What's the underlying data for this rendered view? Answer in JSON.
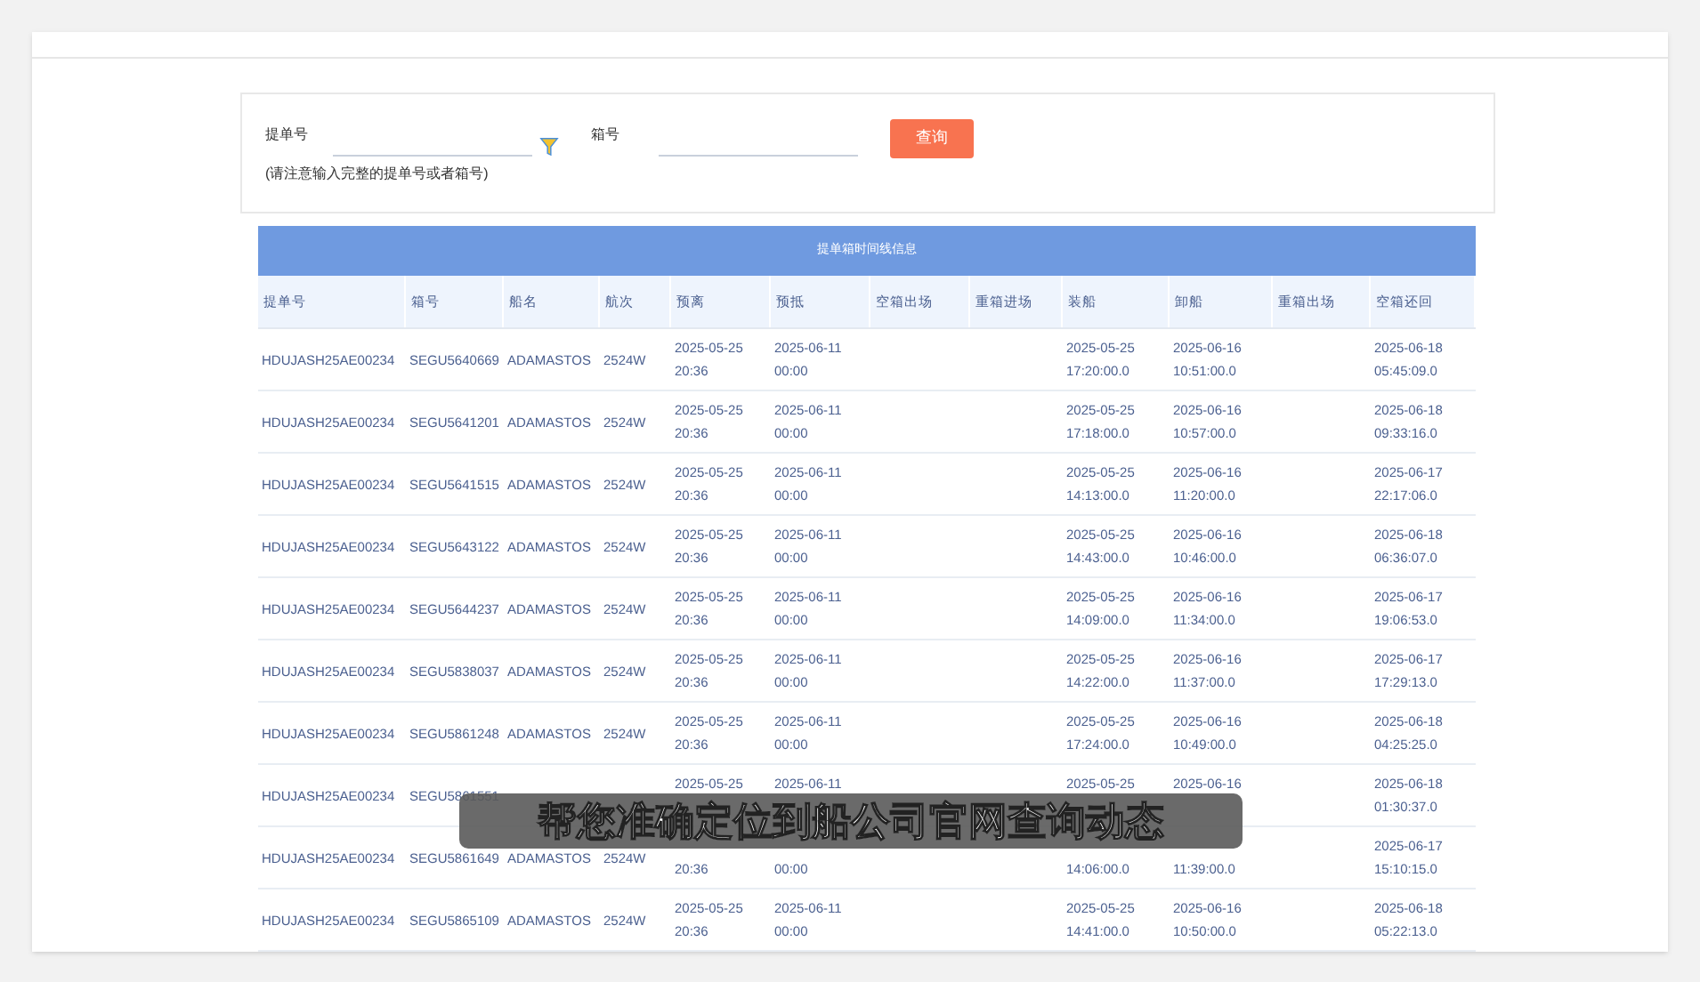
{
  "search": {
    "fields": [
      {
        "label": "提单号",
        "has_filter": true
      },
      {
        "label": "箱号",
        "has_filter": false
      }
    ],
    "button": "查询",
    "note": "(请注意输入完整的提单号或者箱号)"
  },
  "table": {
    "title": "提单箱时间线信息",
    "columns": [
      "提单号",
      "箱号",
      "船名",
      "航次",
      "预离",
      "预抵",
      "空箱出场",
      "重箱进场",
      "装船",
      "卸船",
      "重箱出场",
      "空箱还回"
    ],
    "rows": [
      {
        "cells": [
          [
            "HDUJASH25AE00234"
          ],
          [
            "SEGU5640669"
          ],
          [
            "ADAMASTOS"
          ],
          [
            "2524W"
          ],
          [
            "2025-05-25",
            "20:36"
          ],
          [
            "2025-06-11",
            "00:00"
          ],
          null,
          null,
          [
            "2025-05-25",
            "17:20:00.0"
          ],
          [
            "2025-06-16",
            "10:51:00.0"
          ],
          null,
          [
            "2025-06-18",
            "05:45:09.0"
          ]
        ]
      },
      {
        "cells": [
          [
            "HDUJASH25AE00234"
          ],
          [
            "SEGU5641201"
          ],
          [
            "ADAMASTOS"
          ],
          [
            "2524W"
          ],
          [
            "2025-05-25",
            "20:36"
          ],
          [
            "2025-06-11",
            "00:00"
          ],
          null,
          null,
          [
            "2025-05-25",
            "17:18:00.0"
          ],
          [
            "2025-06-16",
            "10:57:00.0"
          ],
          null,
          [
            "2025-06-18",
            "09:33:16.0"
          ]
        ]
      },
      {
        "cells": [
          [
            "HDUJASH25AE00234"
          ],
          [
            "SEGU5641515"
          ],
          [
            "ADAMASTOS"
          ],
          [
            "2524W"
          ],
          [
            "2025-05-25",
            "20:36"
          ],
          [
            "2025-06-11",
            "00:00"
          ],
          null,
          null,
          [
            "2025-05-25",
            "14:13:00.0"
          ],
          [
            "2025-06-16",
            "11:20:00.0"
          ],
          null,
          [
            "2025-06-17",
            "22:17:06.0"
          ]
        ]
      },
      {
        "cells": [
          [
            "HDUJASH25AE00234"
          ],
          [
            "SEGU5643122"
          ],
          [
            "ADAMASTOS"
          ],
          [
            "2524W"
          ],
          [
            "2025-05-25",
            "20:36"
          ],
          [
            "2025-06-11",
            "00:00"
          ],
          null,
          null,
          [
            "2025-05-25",
            "14:43:00.0"
          ],
          [
            "2025-06-16",
            "10:46:00.0"
          ],
          null,
          [
            "2025-06-18",
            "06:36:07.0"
          ]
        ]
      },
      {
        "cells": [
          [
            "HDUJASH25AE00234"
          ],
          [
            "SEGU5644237"
          ],
          [
            "ADAMASTOS"
          ],
          [
            "2524W"
          ],
          [
            "2025-05-25",
            "20:36"
          ],
          [
            "2025-06-11",
            "00:00"
          ],
          null,
          null,
          [
            "2025-05-25",
            "14:09:00.0"
          ],
          [
            "2025-06-16",
            "11:34:00.0"
          ],
          null,
          [
            "2025-06-17",
            "19:06:53.0"
          ]
        ]
      },
      {
        "cells": [
          [
            "HDUJASH25AE00234"
          ],
          [
            "SEGU5838037"
          ],
          [
            "ADAMASTOS"
          ],
          [
            "2524W"
          ],
          [
            "2025-05-25",
            "20:36"
          ],
          [
            "2025-06-11",
            "00:00"
          ],
          null,
          null,
          [
            "2025-05-25",
            "14:22:00.0"
          ],
          [
            "2025-06-16",
            "11:37:00.0"
          ],
          null,
          [
            "2025-06-17",
            "17:29:13.0"
          ]
        ]
      },
      {
        "cells": [
          [
            "HDUJASH25AE00234"
          ],
          [
            "SEGU5861248"
          ],
          [
            "ADAMASTOS"
          ],
          [
            "2524W"
          ],
          [
            "2025-05-25",
            "20:36"
          ],
          [
            "2025-06-11",
            "00:00"
          ],
          null,
          null,
          [
            "2025-05-25",
            "17:24:00.0"
          ],
          [
            "2025-06-16",
            "10:49:00.0"
          ],
          null,
          [
            "2025-06-18",
            "04:25:25.0"
          ]
        ]
      },
      {
        "cells": [
          [
            "HDUJASH25AE00234"
          ],
          [
            "SEGU5861551"
          ],
          null,
          null,
          [
            "2025-05-25",
            null
          ],
          [
            "2025-06-11",
            null
          ],
          null,
          null,
          [
            "2025-05-25",
            null
          ],
          [
            "2025-06-16",
            null
          ],
          null,
          [
            "2025-06-18",
            "01:30:37.0"
          ]
        ]
      },
      {
        "cells": [
          [
            "HDUJASH25AE00234"
          ],
          [
            "SEGU5861649"
          ],
          [
            "ADAMASTOS"
          ],
          [
            "2524W"
          ],
          [
            null,
            "20:36"
          ],
          [
            null,
            "00:00"
          ],
          null,
          null,
          [
            null,
            "14:06:00.0"
          ],
          [
            null,
            "11:39:00.0"
          ],
          null,
          [
            "2025-06-17",
            "15:10:15.0"
          ]
        ]
      },
      {
        "cells": [
          [
            "HDUJASH25AE00234"
          ],
          [
            "SEGU5865109"
          ],
          [
            "ADAMASTOS"
          ],
          [
            "2524W"
          ],
          [
            "2025-05-25",
            "20:36"
          ],
          [
            "2025-06-11",
            "00:00"
          ],
          null,
          null,
          [
            "2025-05-25",
            "14:41:00.0"
          ],
          [
            "2025-06-16",
            "10:50:00.0"
          ],
          null,
          [
            "2025-06-18",
            "05:22:13.0"
          ]
        ]
      }
    ]
  },
  "subtitle": "帮您准确定位到船公司官网查询动态"
}
